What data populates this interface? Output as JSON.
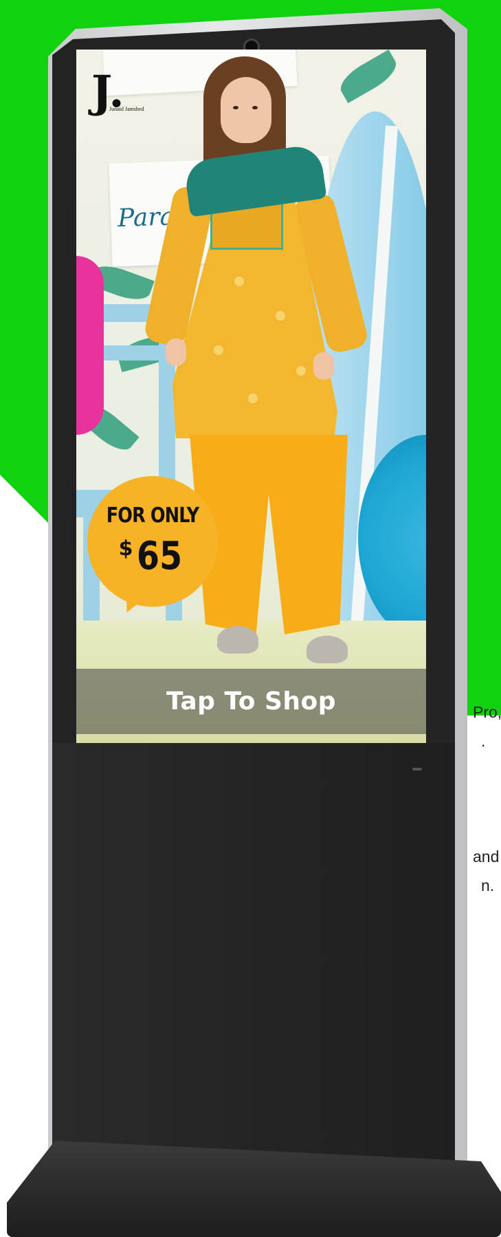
{
  "page": {
    "side_text": [
      "Pro,",
      ".",
      "and",
      "n."
    ]
  },
  "screen": {
    "brand": {
      "logo_letter": "J.",
      "logo_name": "Junaid Jamshed"
    },
    "decor": {
      "sign_text": "Paradise"
    },
    "promo": {
      "line1": "FOR ONLY",
      "currency": "$",
      "amount": "65"
    },
    "cta": {
      "label": "Tap To Shop"
    }
  },
  "colors": {
    "background_accent": "#11d20f",
    "badge": "#f7b226",
    "kiosk_body": "#232323"
  }
}
